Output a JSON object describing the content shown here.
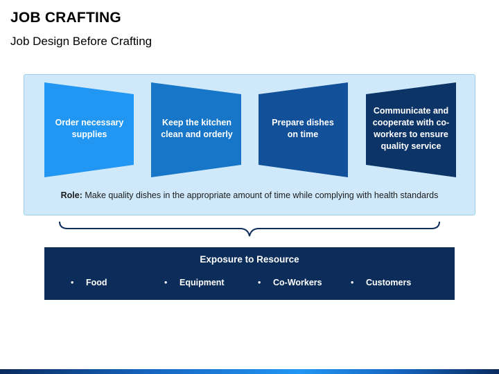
{
  "header": {
    "title": "JOB CRAFTING",
    "subtitle": "Job Design Before Crafting"
  },
  "tasks": [
    {
      "label": "Order necessary supplies",
      "color": "#2196f3"
    },
    {
      "label": "Keep the kitchen clean and orderly",
      "color": "#1776c8"
    },
    {
      "label": "Prepare dishes on time",
      "color": "#12509a"
    },
    {
      "label": "Communicate and cooperate with co-workers to ensure quality service",
      "color": "#0c3467"
    }
  ],
  "role": {
    "label": "Role:",
    "text": "Make quality dishes in the appropriate amount of time while complying with health standards"
  },
  "resources": {
    "title": "Exposure to Resource",
    "items": [
      "Food",
      "Equipment",
      "Co-Workers",
      "Customers"
    ],
    "bullet": "•"
  },
  "colors": {
    "panel_bg": "#cfe9fb",
    "resource_bg": "#0c2d5a",
    "brace": "#0c2d5a"
  }
}
